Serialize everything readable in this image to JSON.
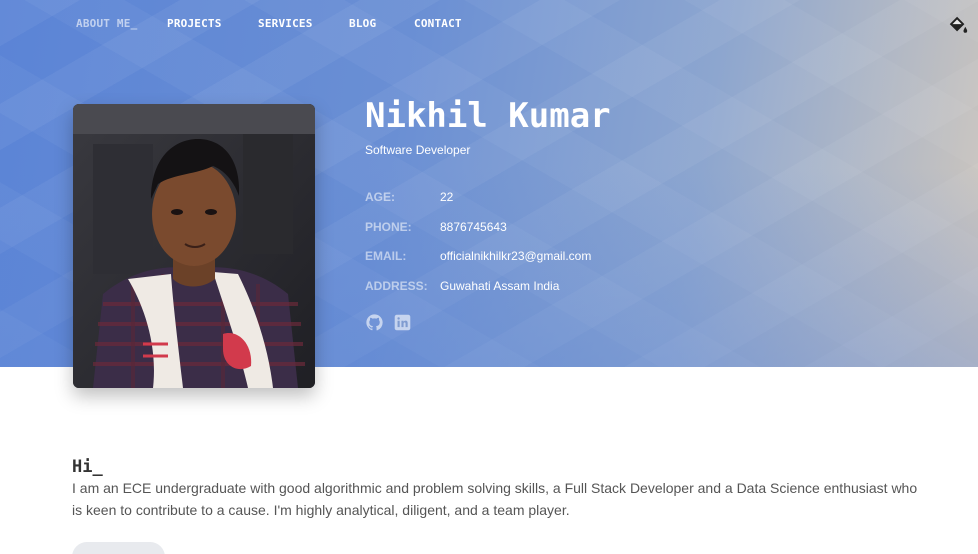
{
  "nav": {
    "items": [
      {
        "label": "ABOUT ME_",
        "active": true
      },
      {
        "label": "PROJECTS"
      },
      {
        "label": "SERVICES"
      },
      {
        "label": "BLOG"
      },
      {
        "label": "CONTACT"
      }
    ],
    "theme_icon": "paint-bucket-icon"
  },
  "profile": {
    "name": "Nikhil Kumar",
    "role": "Software Developer",
    "details": [
      {
        "label": "AGE:",
        "value": "22"
      },
      {
        "label": "PHONE:",
        "value": "8876745643"
      },
      {
        "label": "EMAIL:",
        "value": "officialnikhilkr23@gmail.com"
      },
      {
        "label": "ADDRESS:",
        "value": "Guwahati Assam India"
      }
    ],
    "socials": [
      "github-icon",
      "linkedin-icon"
    ]
  },
  "about": {
    "heading": "Hi_",
    "bio": "I am an ECE undergraduate with good algorithmic and problem solving skills, a Full Stack Developer and a Data Science enthusiast who is keen to contribute to a cause. I'm highly analytical, diligent, and a team player."
  },
  "colors": {
    "hero_start": "#5b84d6",
    "hero_end": "#cfc7bd",
    "text_dark": "#333333",
    "text_muted": "#555555"
  }
}
